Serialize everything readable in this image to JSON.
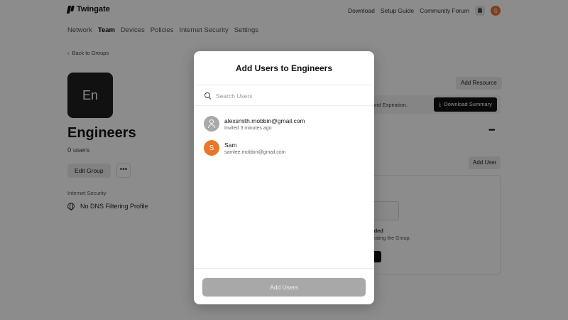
{
  "topbar": {
    "brand": "Twingate",
    "links": [
      "Download",
      "Setup Guide",
      "Community Forum"
    ],
    "avatar_initial": "S"
  },
  "nav": {
    "items": [
      {
        "label": "Network",
        "active": false
      },
      {
        "label": "Team",
        "active": true
      },
      {
        "label": "Devices",
        "active": false
      },
      {
        "label": "Policies",
        "active": false
      },
      {
        "label": "Internet Security",
        "active": false
      },
      {
        "label": "Settings",
        "active": false
      }
    ]
  },
  "group": {
    "back_link": "Back to Groups",
    "tile_initials": "En",
    "name": "Engineers",
    "user_count": "0 users",
    "edit_label": "Edit Group",
    "internet_security_label": "Internet Security",
    "dns_profile": "No DNS Filtering Profile"
  },
  "right_panel": {
    "add_resource": "Add Resource",
    "banner_text": "and Expiration.",
    "download_summary": "Download Summary",
    "add_user": "Add User",
    "empty_title": "dded",
    "empty_sub": "reating the Group."
  },
  "modal": {
    "title": "Add Users to Engineers",
    "search_placeholder": "Search Users",
    "search_value": "",
    "users": [
      {
        "primary": "alexsmith.mobbin@gmail.com",
        "secondary": "Invited 3 minutes ago",
        "avatar": "person-icon"
      },
      {
        "primary": "Sam",
        "secondary": "samlee.mobbin@gmail.com",
        "avatar_initial": "S"
      }
    ],
    "submit_label": "Add Users"
  },
  "colors": {
    "accent_orange": "#e8762b",
    "overlay": "rgba(0,0,0,0.45)",
    "disabled_button": "#a8a8a8"
  }
}
